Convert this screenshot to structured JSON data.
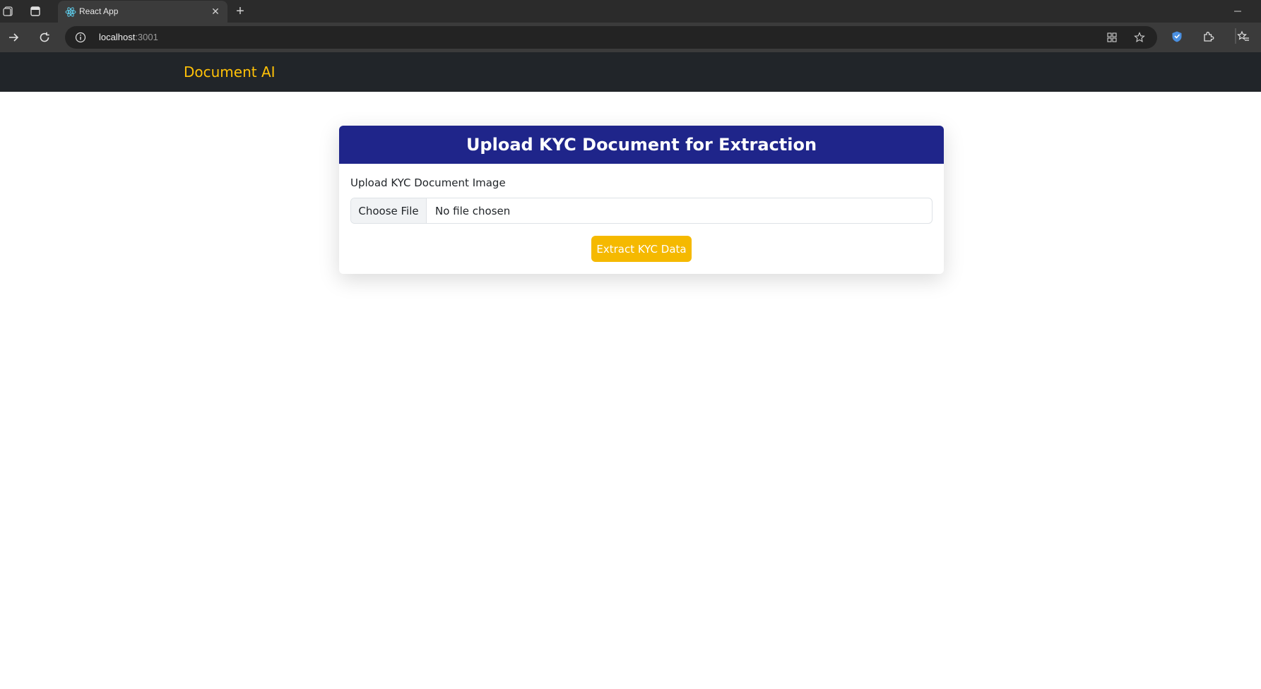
{
  "browser": {
    "tab_title": "React App",
    "url_host": "localhost",
    "url_port": ":3001",
    "icons": [
      "workspaces-icon",
      "tab-actions-icon",
      "react-favicon-icon",
      "close-tab-icon",
      "new-tab-icon",
      "minimize-icon",
      "forward-icon",
      "reload-icon",
      "site-info-icon",
      "app-available-icon",
      "favorite-star-icon",
      "extension-shield-icon",
      "extensions-icon",
      "favorites-icon"
    ]
  },
  "navbar": {
    "brand": "Document AI",
    "brand_color": "#ffc107"
  },
  "card": {
    "title": "Upload KYC Document for Extraction",
    "header_color": "#1f258a",
    "field_label": "Upload KYC Document Image",
    "file_button": "Choose File",
    "file_status": "No file chosen",
    "submit_label": "Extract KYC Data",
    "submit_color": "#f5b900"
  }
}
